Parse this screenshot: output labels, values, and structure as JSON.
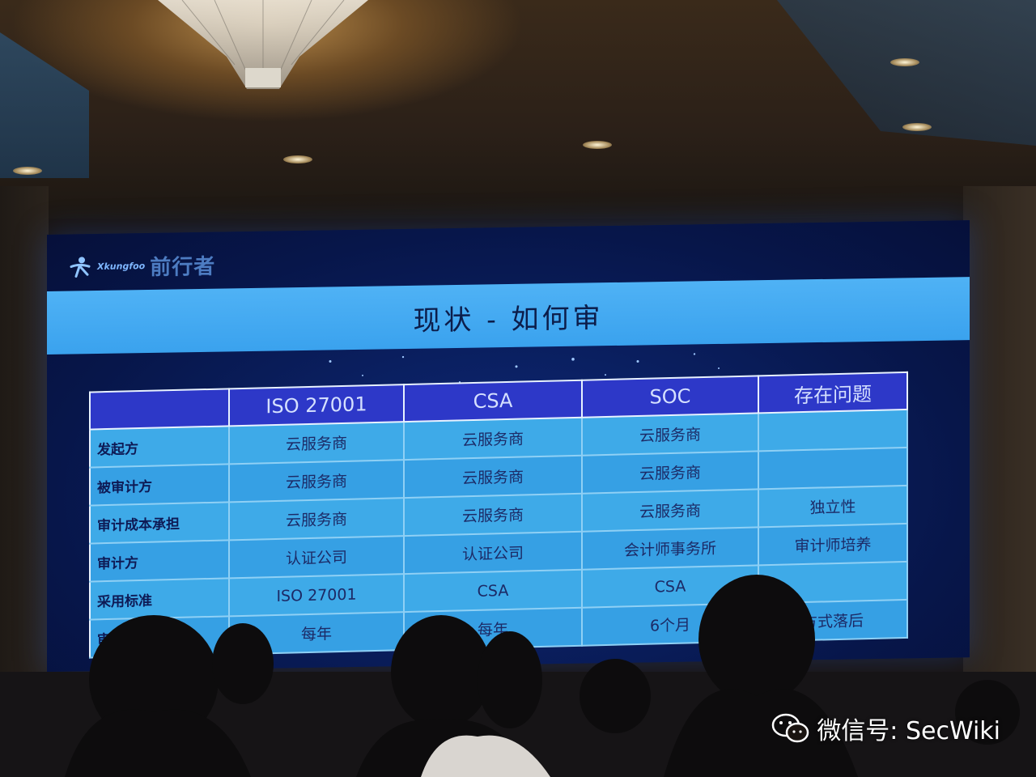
{
  "logo": {
    "english": "Xkungfoo",
    "chinese": "前行者"
  },
  "slide": {
    "title": "现状 - 如何审"
  },
  "table": {
    "headers": [
      "",
      "ISO 27001",
      "CSA",
      "SOC",
      "存在问题"
    ],
    "rows": [
      {
        "label": "发起方",
        "cells": [
          "云服务商",
          "云服务商",
          "云服务商",
          ""
        ]
      },
      {
        "label": "被审计方",
        "cells": [
          "云服务商",
          "云服务商",
          "云服务商",
          ""
        ]
      },
      {
        "label": "审计成本承担",
        "cells": [
          "云服务商",
          "云服务商",
          "云服务商",
          "独立性"
        ]
      },
      {
        "label": "审计方",
        "cells": [
          "认证公司",
          "认证公司",
          "会计师事务所",
          "审计师培养"
        ]
      },
      {
        "label": "采用标准",
        "cells": [
          "ISO 27001",
          "CSA",
          "CSA",
          ""
        ]
      },
      {
        "label": "审计",
        "cells": [
          "每年",
          "每年",
          "6个月",
          "方式落后"
        ]
      }
    ]
  },
  "watermark": {
    "text": "微信号: SecWiki",
    "icon": "wechat-icon"
  },
  "colors": {
    "header_fill": "#2d38c8",
    "cell_fill": "#3eaae8",
    "title_band": "#4fb2f5"
  }
}
